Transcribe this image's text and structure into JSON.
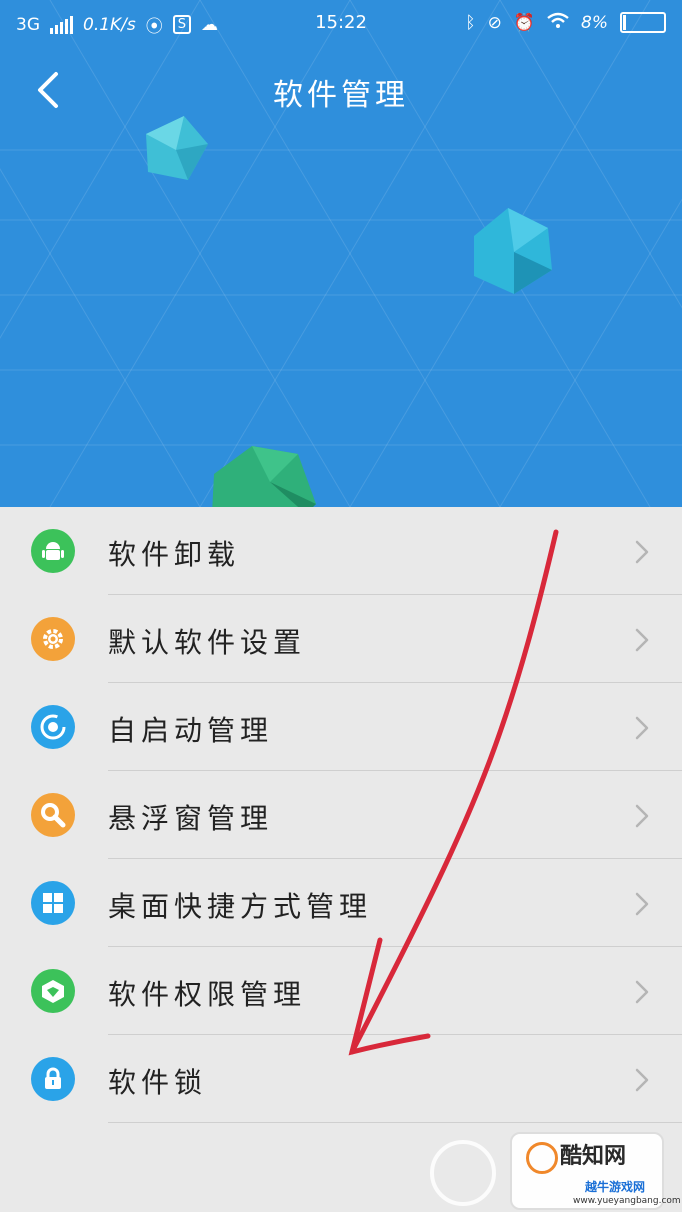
{
  "status_bar": {
    "network": "3G",
    "speed": "0.1K/s",
    "time": "15:22",
    "battery": "8%",
    "battery_level": 0.08,
    "icons": [
      "signal-icon",
      "vpn-icon",
      "s-app-icon",
      "wechat-icon",
      "bluetooth-icon",
      "mute-icon",
      "alarm-icon",
      "wifi-icon",
      "battery-icon"
    ]
  },
  "header": {
    "title": "软件管理",
    "back_icon": "back-chevron-icon",
    "background": "#2f8fdc"
  },
  "menu": {
    "items": [
      {
        "label": "软件卸载",
        "icon": "android-icon",
        "color": "#3cc25a"
      },
      {
        "label": "默认软件设置",
        "icon": "gear-icon",
        "color": "#f3a23a"
      },
      {
        "label": "自启动管理",
        "icon": "power-cycle-icon",
        "color": "#2aa3e8"
      },
      {
        "label": "悬浮窗管理",
        "icon": "wrench-icon",
        "color": "#f3a23a"
      },
      {
        "label": "桌面快捷方式管理",
        "icon": "grid-icon",
        "color": "#2aa3e8"
      },
      {
        "label": "软件权限管理",
        "icon": "shield-cube-icon",
        "color": "#3cc25a"
      },
      {
        "label": "软件锁",
        "icon": "lock-icon",
        "color": "#2aa3e8"
      }
    ],
    "chevron_icon": "chevron-right-icon"
  },
  "annotation": {
    "description_icon": "red-hand-drawn-arrow",
    "color": "#d8283a"
  },
  "watermark": {
    "brand": "酷知网",
    "site_cn": "越牛游戏网",
    "site_url": "www.yueyangbang.com"
  }
}
